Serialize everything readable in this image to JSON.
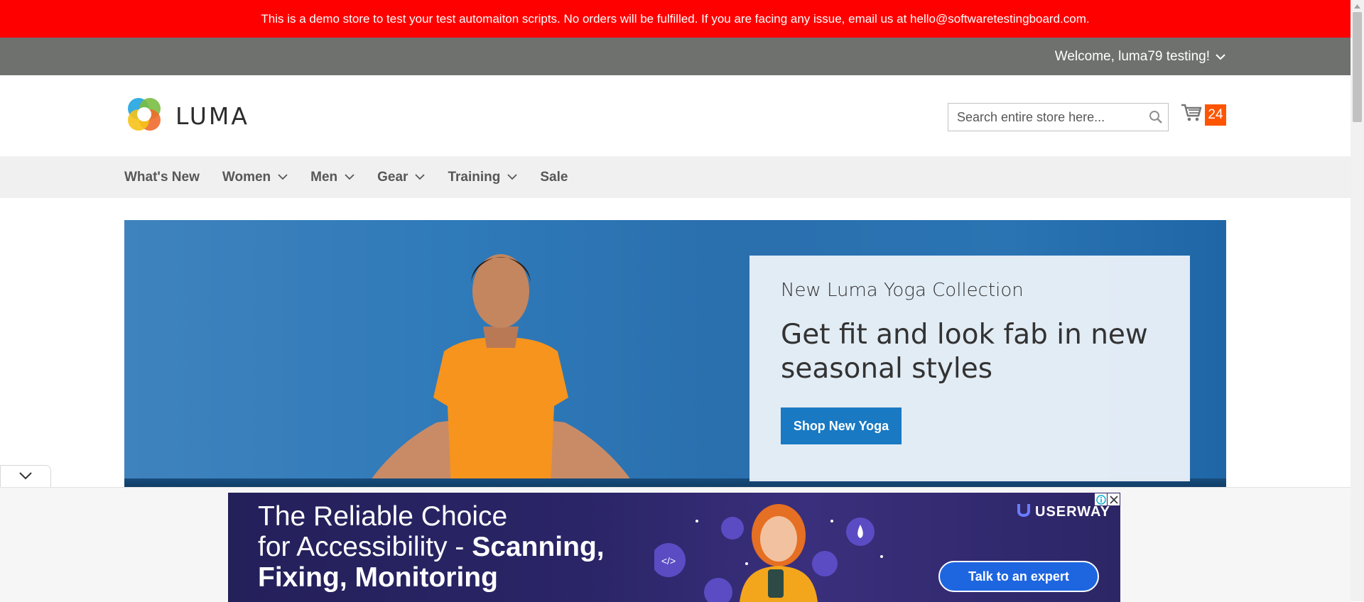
{
  "demo_notice": "This is a demo store to test your test automaiton scripts. No orders will be fulfilled. If you are facing any issue, email us at hello@softwaretestingboard.com.",
  "header_panel": {
    "welcome": "Welcome, luma79 testing!"
  },
  "logo": {
    "text": "LUMA"
  },
  "search": {
    "placeholder": "Search entire store here..."
  },
  "cart": {
    "count": "24"
  },
  "nav": {
    "items": [
      {
        "label": "What's New",
        "has_dropdown": false
      },
      {
        "label": "Women",
        "has_dropdown": true
      },
      {
        "label": "Men",
        "has_dropdown": true
      },
      {
        "label": "Gear",
        "has_dropdown": true
      },
      {
        "label": "Training",
        "has_dropdown": true
      },
      {
        "label": "Sale",
        "has_dropdown": false
      }
    ]
  },
  "hero": {
    "subtitle": "New Luma Yoga Collection",
    "title": "Get fit and look fab in new seasonal styles",
    "button": "Shop New Yoga"
  },
  "ad": {
    "line1": "The Reliable Choice",
    "line2_normal": "for Accessibility - ",
    "line2_bold": "Scanning,",
    "line3": "Fixing, Monitoring",
    "brand": "USERWAY",
    "cta": "Talk to an expert"
  },
  "colors": {
    "demo_bar": "#ff0000",
    "top_panel": "#6e716e",
    "nav_bg": "#f0f0f0",
    "primary_button": "#1979c3",
    "cart_badge": "#ff5501",
    "ad_bg": "#2a2567"
  },
  "icons": {
    "welcome_toggle": "chevron-down-icon",
    "search": "search-icon",
    "cart": "cart-icon",
    "nav_dropdown": "chevron-down-icon",
    "collapse": "chevron-down-icon",
    "ad_close": "close-icon",
    "ad_info": "info-icon"
  }
}
